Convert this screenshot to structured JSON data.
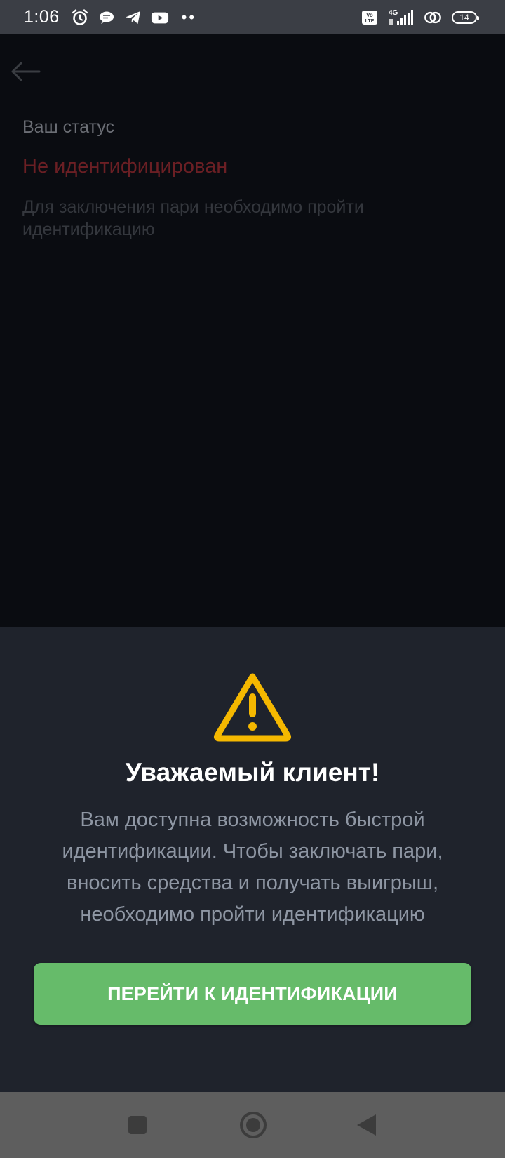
{
  "status_bar": {
    "time": "1:06",
    "network": "4G",
    "volte": "Vo LTE",
    "battery": "14",
    "icons": [
      "alarm-icon",
      "chat-icon",
      "telegram-icon",
      "youtube-icon",
      "more-dots-icon",
      "volte-icon",
      "signal-icon",
      "hotspot-icon",
      "battery-icon"
    ]
  },
  "page": {
    "status_label": "Ваш статус",
    "status_value": "Не идентифицирован",
    "status_desc": "Для заключения пари необходимо пройти идентификацию"
  },
  "sheet": {
    "title": "Уважаемый клиент!",
    "text": "Вам доступна возможность быстрой идентификации. Чтобы заключать пари, вносить средства и получать выигрыш, необходимо пройти идентификацию",
    "button_label": "ПЕРЕЙТИ К ИДЕНТИФИКАЦИИ"
  },
  "colors": {
    "accent_green": "#66bb6a",
    "warning_yellow": "#f5b800",
    "error_red": "#6b1f24",
    "sheet_bg": "#1f232c"
  }
}
